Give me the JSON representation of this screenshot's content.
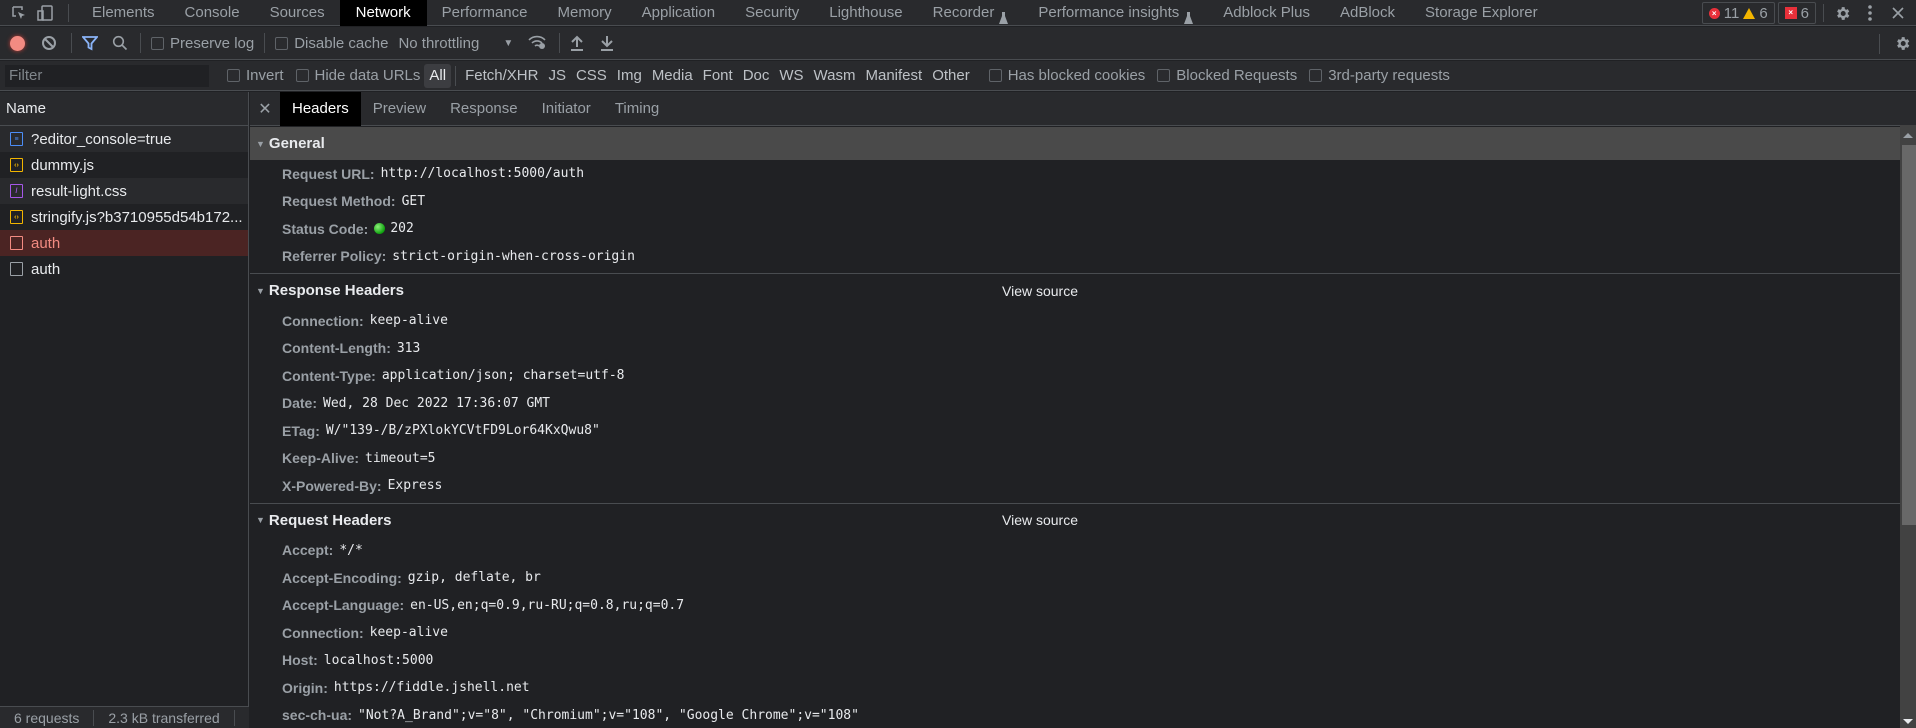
{
  "tabbar": {
    "tabs": [
      {
        "label": "Elements"
      },
      {
        "label": "Console"
      },
      {
        "label": "Sources"
      },
      {
        "label": "Network",
        "active": true
      },
      {
        "label": "Performance"
      },
      {
        "label": "Memory"
      },
      {
        "label": "Application"
      },
      {
        "label": "Security"
      },
      {
        "label": "Lighthouse"
      },
      {
        "label": "Recorder",
        "experimental": true
      },
      {
        "label": "Performance insights",
        "experimental": true
      },
      {
        "label": "Adblock Plus"
      },
      {
        "label": "AdBlock"
      },
      {
        "label": "Storage Explorer"
      }
    ],
    "errors_count": "11",
    "warnings_count": "6",
    "issues_count": "6"
  },
  "toolbar": {
    "preserve_log": "Preserve log",
    "disable_cache": "Disable cache",
    "throttling": "No throttling"
  },
  "filterbar": {
    "filter_placeholder": "Filter",
    "invert": "Invert",
    "hide_data_urls": "Hide data URLs",
    "types": [
      "All",
      "Fetch/XHR",
      "JS",
      "CSS",
      "Img",
      "Media",
      "Font",
      "Doc",
      "WS",
      "Wasm",
      "Manifest",
      "Other"
    ],
    "active_type": "All",
    "has_blocked_cookies": "Has blocked cookies",
    "blocked_requests": "Blocked Requests",
    "third_party": "3rd-party requests"
  },
  "requests": {
    "header": "Name",
    "items": [
      {
        "name": "?editor_console=true",
        "type": "doc"
      },
      {
        "name": "dummy.js",
        "type": "js"
      },
      {
        "name": "result-light.css",
        "type": "css"
      },
      {
        "name": "stringify.js?b3710955d54b172...",
        "type": "js"
      },
      {
        "name": "auth",
        "type": "err"
      },
      {
        "name": "auth",
        "type": "plain"
      }
    ],
    "summary_requests": "6 requests",
    "summary_transferred": "2.3 kB transferred"
  },
  "details": {
    "tabs": [
      "Headers",
      "Preview",
      "Response",
      "Initiator",
      "Timing"
    ],
    "active_tab": "Headers",
    "view_source": "View source",
    "general": {
      "title": "General",
      "rows": [
        {
          "name": "Request URL:",
          "value": "http://localhost:5000/auth"
        },
        {
          "name": "Request Method:",
          "value": "GET"
        },
        {
          "name": "Status Code:",
          "value": "202",
          "status_ok": true
        },
        {
          "name": "Referrer Policy:",
          "value": "strict-origin-when-cross-origin"
        }
      ]
    },
    "response_headers": {
      "title": "Response Headers",
      "rows": [
        {
          "name": "Connection:",
          "value": "keep-alive"
        },
        {
          "name": "Content-Length:",
          "value": "313"
        },
        {
          "name": "Content-Type:",
          "value": "application/json; charset=utf-8"
        },
        {
          "name": "Date:",
          "value": "Wed, 28 Dec 2022 17:36:07 GMT"
        },
        {
          "name": "ETag:",
          "value": "W/\"139-/B/zPXlokYCVtFD9Lor64KxQwu8\""
        },
        {
          "name": "Keep-Alive:",
          "value": "timeout=5"
        },
        {
          "name": "X-Powered-By:",
          "value": "Express"
        }
      ]
    },
    "request_headers": {
      "title": "Request Headers",
      "rows": [
        {
          "name": "Accept:",
          "value": "*/*"
        },
        {
          "name": "Accept-Encoding:",
          "value": "gzip, deflate, br"
        },
        {
          "name": "Accept-Language:",
          "value": "en-US,en;q=0.9,ru-RU;q=0.8,ru;q=0.7"
        },
        {
          "name": "Connection:",
          "value": "keep-alive"
        },
        {
          "name": "Host:",
          "value": "localhost:5000"
        },
        {
          "name": "Origin:",
          "value": "https://fiddle.jshell.net"
        },
        {
          "name": "sec-ch-ua:",
          "value": "\"Not?A_Brand\";v=\"8\", \"Chromium\";v=\"108\", \"Google Chrome\";v=\"108\""
        }
      ]
    }
  }
}
